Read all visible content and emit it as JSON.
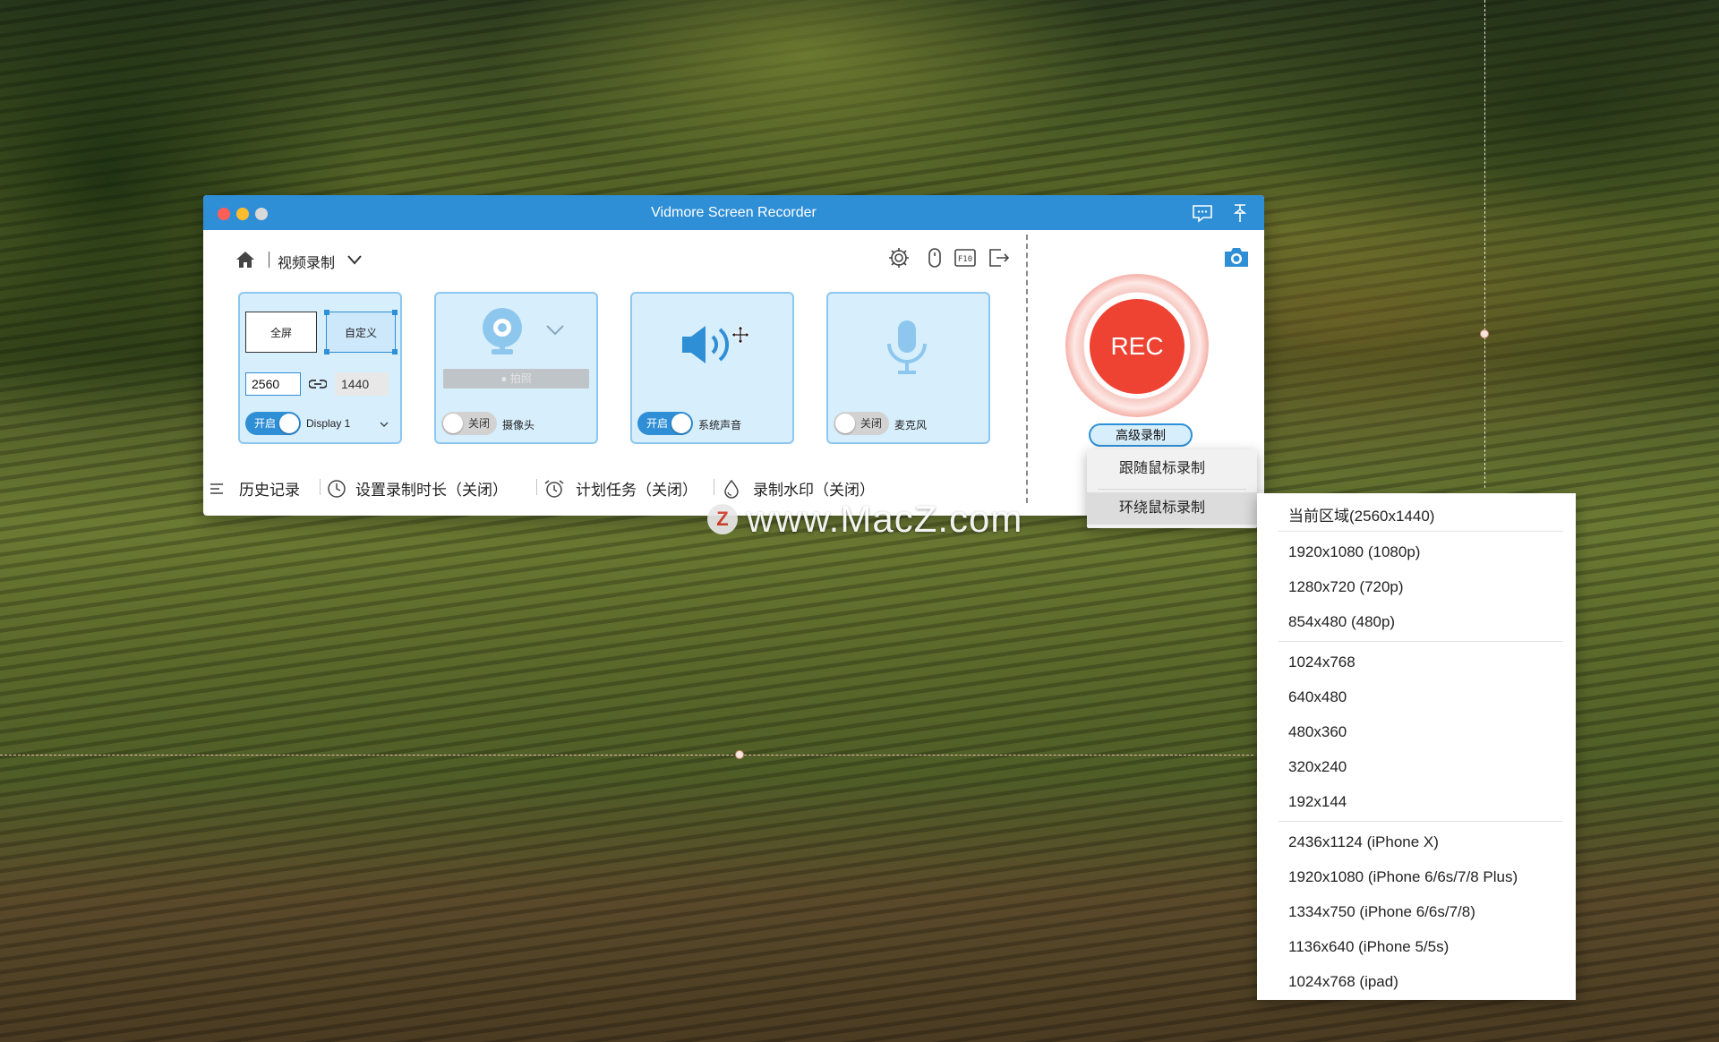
{
  "window": {
    "title": "Vidmore Screen Recorder",
    "mode_label": "视频录制",
    "accent": "#2f8fd6",
    "rec_color": "#ee4232"
  },
  "screen_panel": {
    "full_label": "全屏",
    "custom_label": "自定义",
    "width": "2560",
    "height": "1440",
    "toggle_label": "开启",
    "display_label": "Display 1"
  },
  "camera_panel": {
    "photo_label": "拍照",
    "toggle_label": "关闭",
    "label": "摄像头"
  },
  "sound_panel": {
    "toggle_label": "开启",
    "label": "系统声音"
  },
  "mic_panel": {
    "toggle_label": "关闭",
    "label": "麦克风"
  },
  "rec": {
    "label": "REC",
    "advanced_label": "高级录制"
  },
  "bottom_bar": {
    "history": "历史记录",
    "duration": "设置录制时长（关闭）",
    "schedule": "计划任务（关闭）",
    "watermark": "录制水印（关闭）"
  },
  "advanced_menu": {
    "items": [
      "跟随鼠标录制",
      "环绕鼠标录制"
    ]
  },
  "resolution_menu": {
    "items": [
      "当前区域(2560x1440)",
      "1920x1080 (1080p)",
      "1280x720 (720p)",
      "854x480 (480p)",
      "1024x768",
      "640x480",
      "480x360",
      "320x240",
      "192x144",
      "2436x1124 (iPhone X)",
      "1920x1080 (iPhone 6/6s/7/8 Plus)",
      "1334x750 (iPhone 6/6s/7/8)",
      "1136x640 (iPhone 5/5s)",
      "1024x768 (ipad)"
    ]
  },
  "watermark_overlay": {
    "logo": "Z",
    "text": "www.MacZ.com"
  }
}
